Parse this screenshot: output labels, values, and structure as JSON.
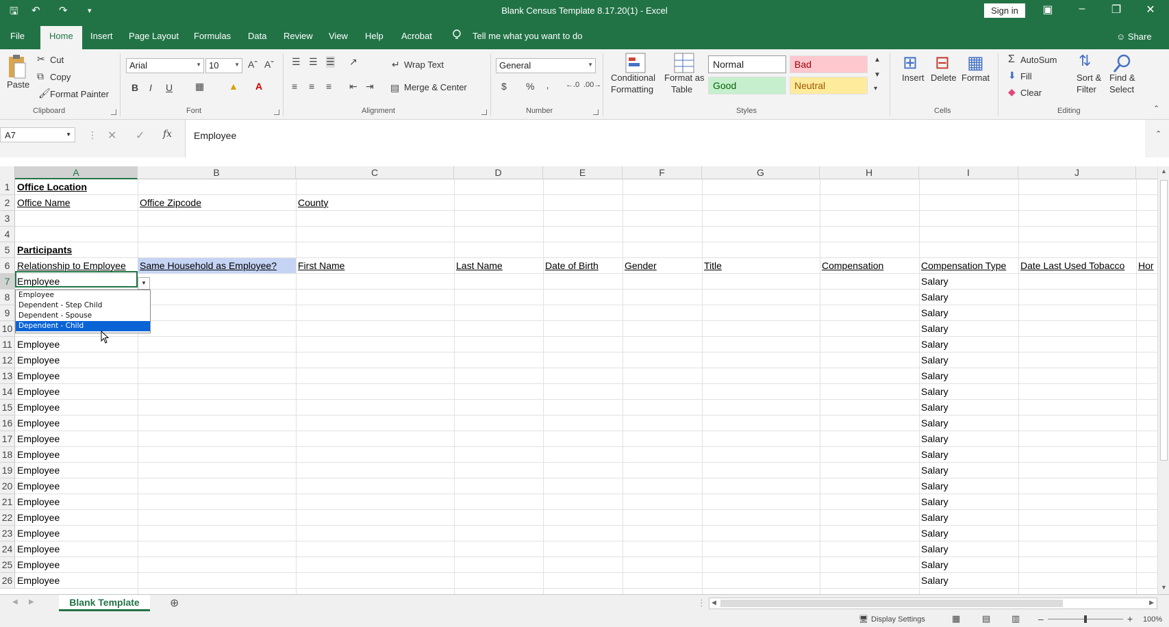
{
  "titlebar": {
    "doc_title": "Blank Census Template 8.17.20(1)  -  Excel",
    "signin": "Sign in"
  },
  "menu": {
    "tabs": [
      "File",
      "Home",
      "Insert",
      "Page Layout",
      "Formulas",
      "Data",
      "Review",
      "View",
      "Help",
      "Acrobat"
    ],
    "active": "Home",
    "tell_me": "Tell me what you want to do",
    "share": "Share"
  },
  "ribbon": {
    "clipboard": {
      "paste": "Paste",
      "cut": "Cut",
      "copy": "Copy",
      "format_painter": "Format Painter",
      "label": "Clipboard"
    },
    "font": {
      "name": "Arial",
      "size": "10",
      "bold": "B",
      "italic": "I",
      "underline": "U",
      "label": "Font"
    },
    "alignment": {
      "wrap": "Wrap Text",
      "merge": "Merge & Center",
      "label": "Alignment"
    },
    "number": {
      "format": "General",
      "currency": "$",
      "percent": "%",
      "comma": "‚",
      "label": "Number"
    },
    "styles": {
      "conditional1": "Conditional",
      "conditional2": "Formatting",
      "format_as1": "Format as",
      "format_as2": "Table",
      "normal": "Normal",
      "bad": "Bad",
      "good": "Good",
      "neutral": "Neutral",
      "label": "Styles"
    },
    "cells": {
      "insert": "Insert",
      "delete": "Delete",
      "format": "Format",
      "label": "Cells"
    },
    "editing": {
      "autosum": "AutoSum",
      "fill": "Fill",
      "clear": "Clear",
      "sort1": "Sort &",
      "sort2": "Filter",
      "find1": "Find &",
      "find2": "Select",
      "label": "Editing"
    },
    "colors": {
      "good_bg": "#c6efce",
      "good_fg": "#006100",
      "bad_bg": "#ffc7ce",
      "bad_fg": "#9c0006",
      "neutral_bg": "#ffeb9c",
      "neutral_fg": "#9c5700"
    }
  },
  "formula_bar": {
    "name_box": "A7",
    "fx": "fx",
    "value": "Employee"
  },
  "columns": [
    "A",
    "B",
    "C",
    "D",
    "E",
    "F",
    "G",
    "H",
    "I",
    "J"
  ],
  "rows": [
    "1",
    "2",
    "3",
    "4",
    "5",
    "6",
    "7",
    "8",
    "9",
    "10",
    "11",
    "12",
    "13",
    "14",
    "15",
    "16",
    "17",
    "18",
    "19",
    "20",
    "21",
    "22",
    "23",
    "24",
    "25",
    "26"
  ],
  "cells": {
    "r1": "Office Location",
    "r2": [
      "Office Name",
      "Office Zipcode",
      "County"
    ],
    "r5": "Participants",
    "r6": [
      "Relationship to Employee",
      "Same Household as Employee?",
      "First Name",
      "Last Name",
      "Date of Birth",
      "Gender",
      "Title",
      "Compensation",
      "Compensation Type",
      "Date Last Used Tobacco",
      "Hor"
    ]
  },
  "col_a_values": [
    "Employee",
    "",
    "",
    "",
    "Employee",
    "Employee",
    "Employee",
    "Employee",
    "Employee",
    "Employee",
    "Employee",
    "Employee",
    "Employee",
    "Employee",
    "Employee",
    "Employee",
    "Employee",
    "Employee",
    "Employee",
    "Employee"
  ],
  "col_i_value": "Salary",
  "dropdown": {
    "items": [
      "Employee",
      "Dependent - Step Child",
      "Dependent - Spouse",
      "Dependent - Child"
    ],
    "selected": 3
  },
  "sheet": {
    "tab": "Blank Template"
  },
  "status": {
    "display_settings": "Display Settings",
    "zoom": "100%"
  }
}
